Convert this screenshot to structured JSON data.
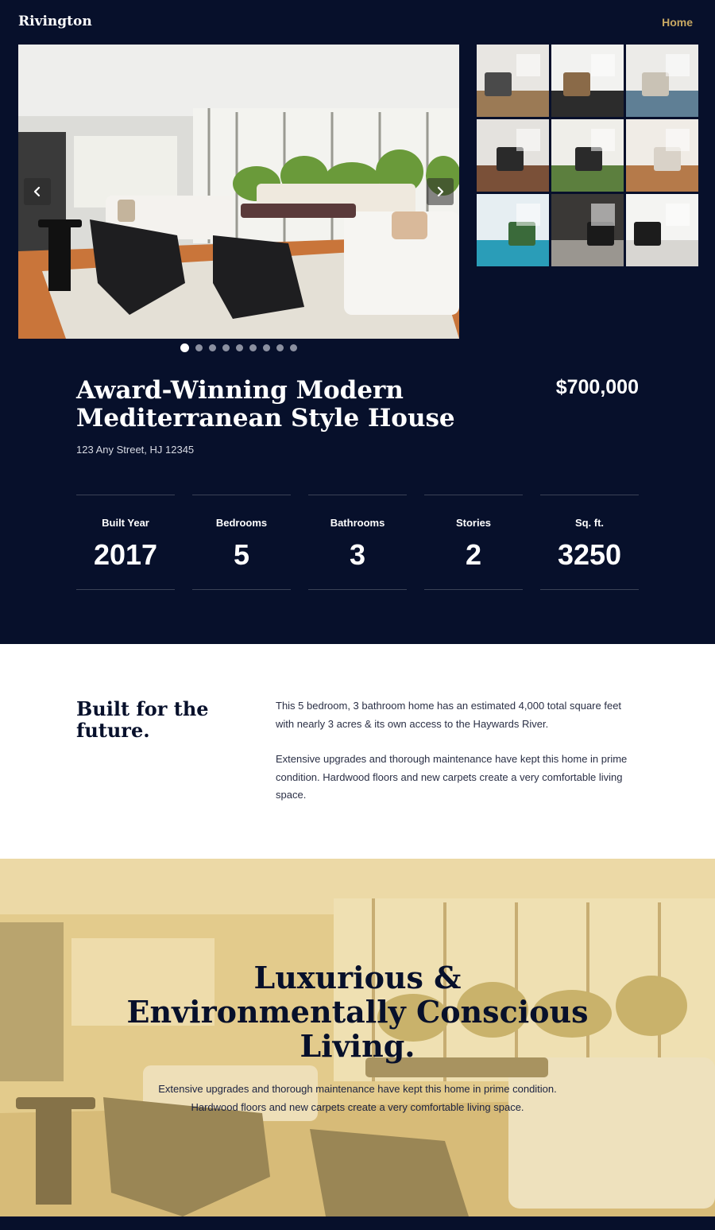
{
  "header": {
    "brand": "Rivington",
    "nav_home": "Home"
  },
  "slider": {
    "photo_alt": "Living room with white sofas and black armchairs",
    "total_slides": 9,
    "active_slide": 1,
    "prev_icon": "chevron-left-icon",
    "next_icon": "chevron-right-icon"
  },
  "thumbnails": [
    {
      "name": "staircase"
    },
    {
      "name": "kitchen"
    },
    {
      "name": "bedroom"
    },
    {
      "name": "living-dining"
    },
    {
      "name": "lounge"
    },
    {
      "name": "bedroom-2"
    },
    {
      "name": "exterior-pool"
    },
    {
      "name": "dark-room"
    },
    {
      "name": "bathroom"
    }
  ],
  "property": {
    "title": "Award-Winning Modern Mediterranean Style House",
    "price": "$700,000",
    "address": "123 Any Street, HJ 12345"
  },
  "stats": [
    {
      "label": "Built Year",
      "value": "2017"
    },
    {
      "label": "Bedrooms",
      "value": "5"
    },
    {
      "label": "Bathrooms",
      "value": "3"
    },
    {
      "label": "Stories",
      "value": "2"
    },
    {
      "label": "Sq. ft.",
      "value": "3250"
    }
  ],
  "about": {
    "heading": "Built for the future.",
    "paragraphs": [
      "This 5 bedroom, 3 bathroom home has an estimated 4,000 total square feet with nearly 3 acres & its own access to the Haywards River.",
      "Extensive upgrades and thorough maintenance have kept this home in prime condition. Hardwood floors and new carpets create a very comfortable living space."
    ]
  },
  "hero": {
    "title": "Luxurious & Environmentally Conscious Living.",
    "text": "Extensive upgrades and thorough maintenance have kept this home in prime condition. Hardwood floors and new carpets create a very comfortable living space."
  },
  "colors": {
    "navy": "#07102b",
    "gold": "#c8a862",
    "hero_overlay": "#e2c987"
  }
}
